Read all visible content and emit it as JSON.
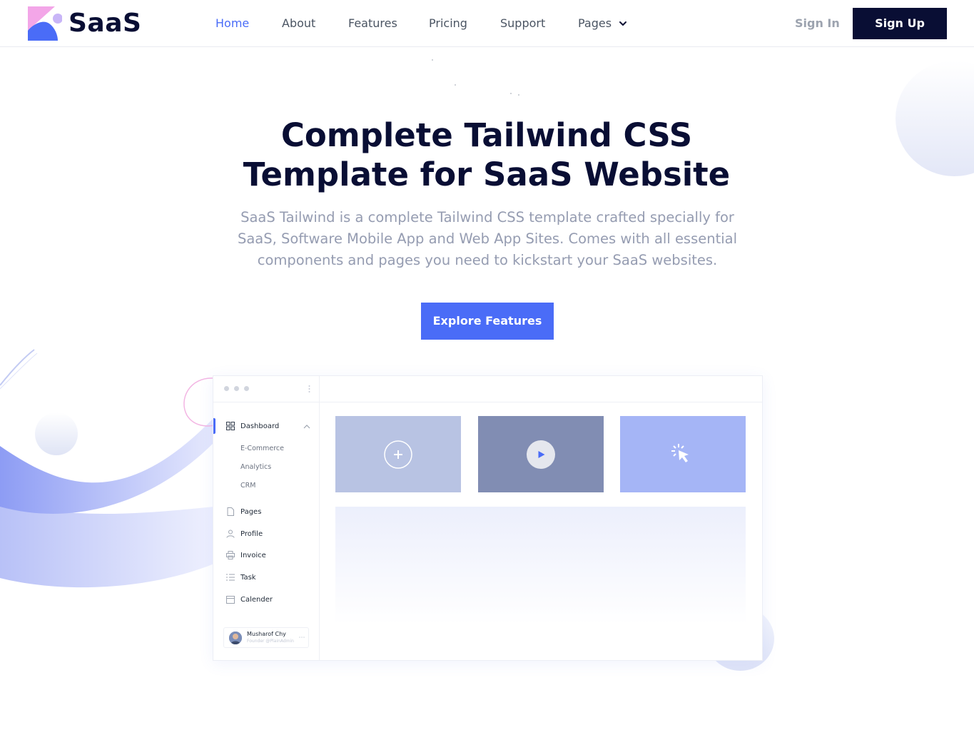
{
  "brand": {
    "name": "SaaS"
  },
  "nav": {
    "items": [
      {
        "label": "Home",
        "active": true
      },
      {
        "label": "About",
        "active": false
      },
      {
        "label": "Features",
        "active": false
      },
      {
        "label": "Pricing",
        "active": false
      },
      {
        "label": "Support",
        "active": false
      },
      {
        "label": "Pages",
        "active": false,
        "has_dropdown": true,
        "icon": "chevron-down-icon"
      }
    ],
    "signin_label": "Sign In",
    "signup_label": "Sign Up"
  },
  "hero": {
    "title_line1": "Complete Tailwind CSS",
    "title_line2": "Template for SaaS Website",
    "subtitle_line1": "SaaS Tailwind is a complete Tailwind CSS template crafted specially for",
    "subtitle_line2": "SaaS, Software Mobile App and Web App Sites. Comes with all essential",
    "subtitle_line3": "components and pages you need to kickstart your SaaS websites.",
    "cta_label": "Explore Features"
  },
  "dashboard": {
    "sidebar": {
      "items": [
        {
          "label": "Dashboard",
          "icon": "grid-icon",
          "active": true,
          "expanded": true
        },
        {
          "label": "Pages",
          "icon": "file-icon"
        },
        {
          "label": "Profile",
          "icon": "user-icon"
        },
        {
          "label": "Invoice",
          "icon": "printer-icon"
        },
        {
          "label": "Task",
          "icon": "list-icon"
        },
        {
          "label": "Calender",
          "icon": "calendar-icon"
        }
      ],
      "subitems": [
        "E-Commerce",
        "Analytics",
        "CRM"
      ],
      "user": {
        "name": "Musharof Chy",
        "role": "Founder @PlainAdmin"
      }
    },
    "cards": [
      {
        "icon": "plus-icon",
        "color": "#b8c3e3"
      },
      {
        "icon": "play-icon",
        "color": "#818db3"
      },
      {
        "icon": "cursor-click-icon",
        "color": "#a5b5f6"
      }
    ]
  },
  "colors": {
    "primary": "#4a6cf7",
    "dark": "#090e34",
    "muted": "#959cb1"
  }
}
